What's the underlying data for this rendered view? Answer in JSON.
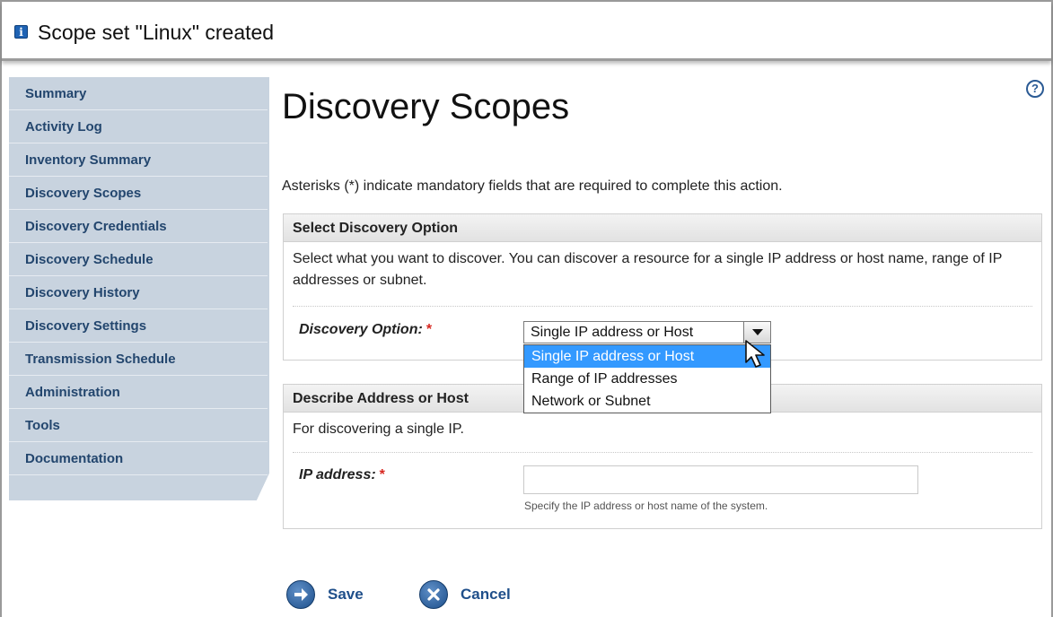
{
  "banner": {
    "icon": "info-icon",
    "message": "Scope set \"Linux\" created"
  },
  "sidebar": {
    "items": [
      {
        "label": "Summary"
      },
      {
        "label": "Activity Log"
      },
      {
        "label": "Inventory Summary"
      },
      {
        "label": "Discovery Scopes"
      },
      {
        "label": "Discovery Credentials"
      },
      {
        "label": "Discovery Schedule"
      },
      {
        "label": "Discovery History"
      },
      {
        "label": "Discovery Settings"
      },
      {
        "label": "Transmission Schedule"
      },
      {
        "label": "Administration"
      },
      {
        "label": "Tools"
      },
      {
        "label": "Documentation"
      }
    ]
  },
  "main": {
    "help_icon": "?",
    "title": "Discovery Scopes",
    "mandatory_note": "Asterisks (*) indicate mandatory fields that are required to complete this action.",
    "option_section": {
      "header": "Select Discovery Option",
      "description": "Select what you want to discover. You can discover a resource for a single IP address or host name, range of IP addresses or subnet.",
      "field_label": "Discovery Option:",
      "required_mark": "*",
      "selected_value": "Single IP address or Host",
      "options": [
        "Single IP address or Host",
        "Range of IP addresses",
        "Network or Subnet"
      ]
    },
    "address_section": {
      "header": "Describe Address or Host",
      "description": "For discovering a single IP.",
      "field_label": "IP address:",
      "required_mark": "*",
      "input_value": "",
      "hint": "Specify the IP address or host name of the system."
    },
    "actions": {
      "save_label": "Save",
      "cancel_label": "Cancel"
    }
  },
  "colors": {
    "sidebar_bg": "#c8d3df",
    "sidebar_text": "#23466e",
    "selected_option": "#3399ff",
    "required": "#d7261f",
    "button_icon": "#1d4f8b"
  }
}
